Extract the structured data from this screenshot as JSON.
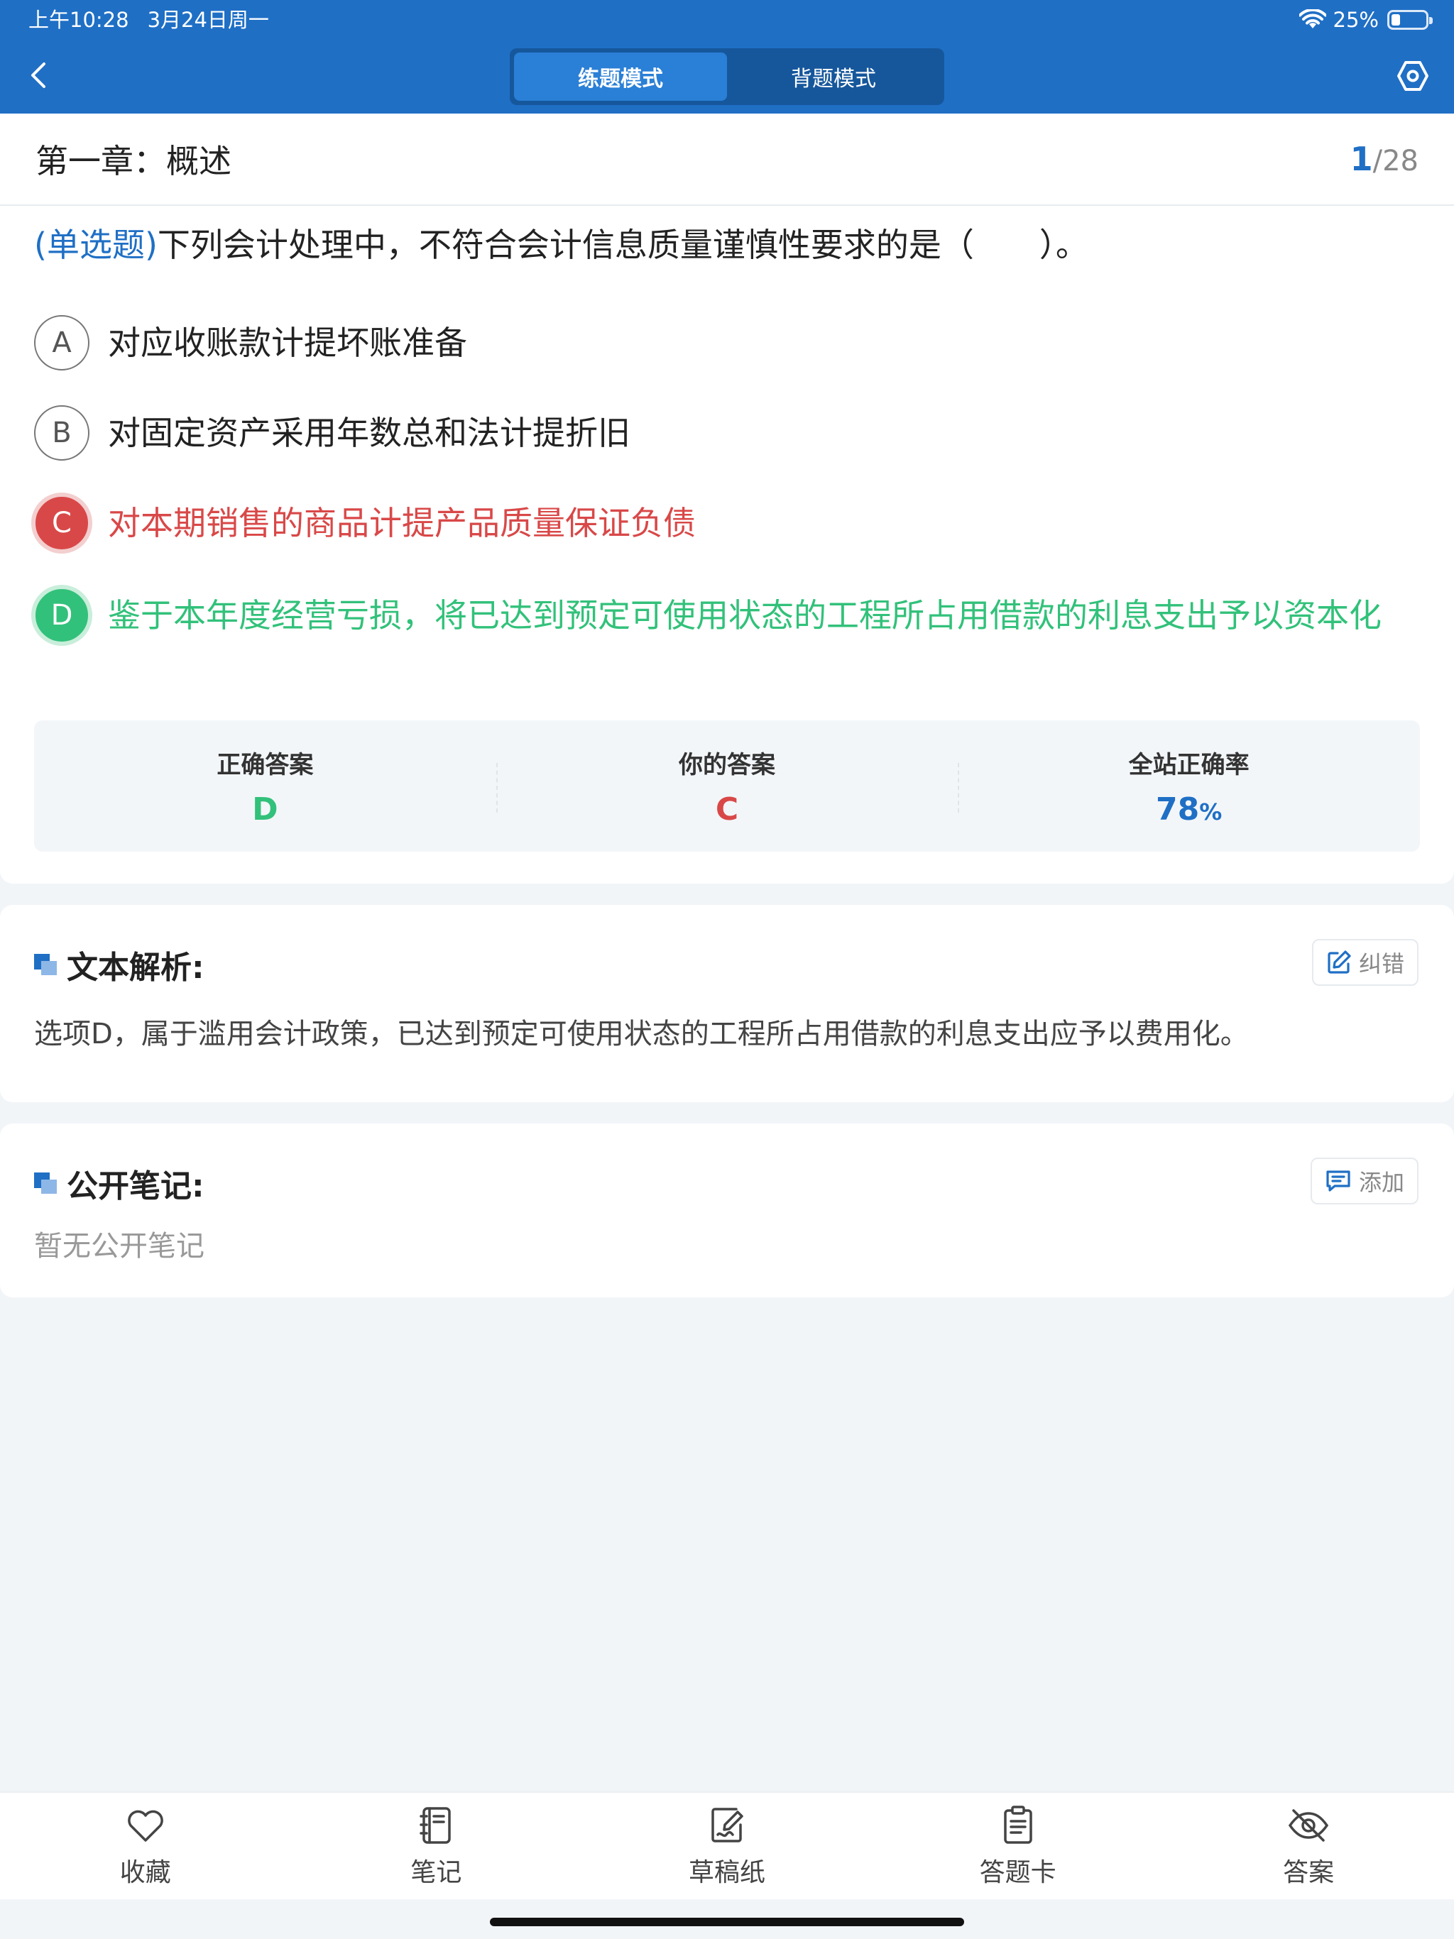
{
  "status": {
    "time": "上午10:28",
    "date": "3月24日周一",
    "battery": "25%",
    "battery_level": 0.25
  },
  "nav": {
    "tabs": [
      {
        "label": "练题模式",
        "active": true
      },
      {
        "label": "背题模式",
        "active": false
      }
    ],
    "back_icon": "chevron-left-icon",
    "settings_icon": "settings-icon"
  },
  "chapter": {
    "title": "第一章：概述",
    "current": "1",
    "total": "/28"
  },
  "question": {
    "type": "(单选题)",
    "text": "下列会计处理中，不符合会计信息质量谨慎性要求的是（　　）。",
    "options": [
      {
        "letter": "A",
        "text": "对应收账款计提坏账准备",
        "state": "normal"
      },
      {
        "letter": "B",
        "text": "对固定资产采用年数总和法计提折旧",
        "state": "normal"
      },
      {
        "letter": "C",
        "text": "对本期销售的商品计提产品质量保证负债",
        "state": "wrong"
      },
      {
        "letter": "D",
        "text": "鉴于本年度经营亏损，将已达到预定可使用状态的工程所占用借款的利息支出予以资本化",
        "state": "correct"
      }
    ]
  },
  "answers": {
    "correct_label": "正确答案",
    "correct_value": "D",
    "yours_label": "你的答案",
    "yours_value": "C",
    "rate_label": "全站正确率",
    "rate_value": "78",
    "rate_unit": "%"
  },
  "explanation": {
    "title": "文本解析:",
    "button": "纠错",
    "text": "选项D，属于滥用会计政策，已达到预定可使用状态的工程所占用借款的利息支出应予以费用化。"
  },
  "notes": {
    "title": "公开笔记:",
    "button": "添加",
    "empty": "暂无公开笔记"
  },
  "toolbar": {
    "items": [
      {
        "label": "收藏",
        "icon": "heart-icon"
      },
      {
        "label": "笔记",
        "icon": "notebook-icon"
      },
      {
        "label": "草稿纸",
        "icon": "scratch-paper-icon"
      },
      {
        "label": "答题卡",
        "icon": "answer-sheet-icon"
      },
      {
        "label": "答案",
        "icon": "eye-off-icon"
      }
    ]
  },
  "colors": {
    "brand": "#1f6fc5",
    "wrong": "#d94848",
    "correct": "#32c17a"
  }
}
